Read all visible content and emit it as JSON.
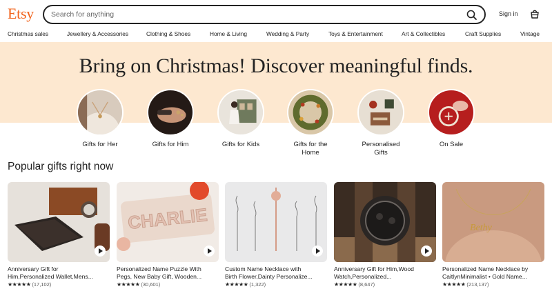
{
  "header": {
    "logo": "Etsy",
    "search_placeholder": "Search for anything",
    "signin": "Sign in",
    "icons": [
      "search-icon",
      "cart-icon"
    ]
  },
  "categories": [
    "Christmas sales",
    "Jewellery & Accessories",
    "Clothing & Shoes",
    "Home & Living",
    "Wedding & Party",
    "Toys & Entertainment",
    "Art & Collectibles",
    "Craft Supplies",
    "Vintage"
  ],
  "banner": {
    "headline": "Bring on Christmas! Discover meaningful finds.",
    "color": "#fde8d0"
  },
  "gift_categories": [
    {
      "line1": "Gifts for Her",
      "line2": ""
    },
    {
      "line1": "Gifts for Him",
      "line2": ""
    },
    {
      "line1": "Gifts for Kids",
      "line2": ""
    },
    {
      "line1": "Gifts for the",
      "line2": "Home"
    },
    {
      "line1": "Personalised",
      "line2": "Gifts"
    },
    {
      "line1": "On Sale",
      "line2": ""
    }
  ],
  "section": {
    "title": "Popular gifts right now"
  },
  "products": [
    {
      "line1": "Anniversary Gift for",
      "line2": "Him,Personalized Wallet,Mens...",
      "stars": "★★★★★",
      "count": "(17,102)"
    },
    {
      "line1": "Personalized Name Puzzle With",
      "line2": "Pegs, New Baby Gift, Wooden...",
      "stars": "★★★★★",
      "count": "(30,601)"
    },
    {
      "line1": "Custom Name Necklace with",
      "line2": "Birth Flower,Dainty Personalize...",
      "stars": "★★★★★",
      "count": "(1,322)"
    },
    {
      "line1": "Anniversary Gift for Him,Wood",
      "line2": "Watch,Personalized...",
      "stars": "★★★★★",
      "count": "(8,647)"
    },
    {
      "line1": "Personalized Name Necklace by",
      "line2": "CaitlynMinimalist • Gold Name...",
      "stars": "★★★★★",
      "count": "(213,137)"
    }
  ],
  "colors": {
    "brand": "#f1641e",
    "banner": "#fde8d0",
    "text": "#222222"
  }
}
